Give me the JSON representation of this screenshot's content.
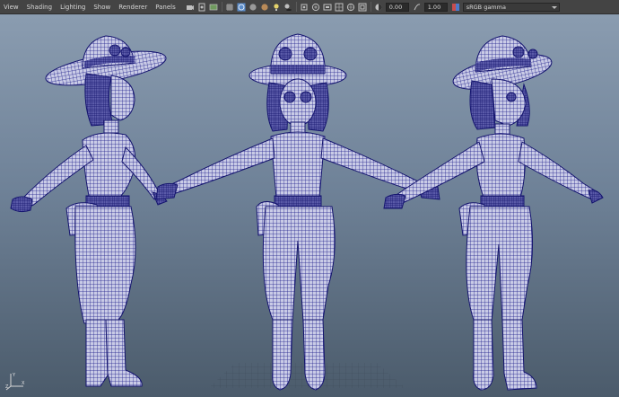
{
  "menu": {
    "items": [
      "View",
      "Shading",
      "Lighting",
      "Show",
      "Renderer",
      "Panels"
    ]
  },
  "toolbar": {
    "icons": [
      "camera-icon",
      "bookmark-icon",
      "image-plane-icon",
      "grid-icon",
      "wireframe-icon",
      "smooth-shade-icon",
      "textured-icon",
      "lights-icon",
      "shadows-icon",
      "isolate-icon",
      "xray-icon",
      "resolution-gate-icon",
      "film-gate-icon",
      "safe-action-icon",
      "field-chart-icon",
      "exposure-icon"
    ],
    "exposure_value": "0.00",
    "gamma_value": "1.00",
    "color_management": "sRGB gamma"
  },
  "viewport": {
    "background_top": "#8a9cb0",
    "background_bottom": "#4b5b6b",
    "wire_color": "#1f1f8a",
    "mesh_fill": "#c9cbe6"
  },
  "axis": {
    "y_label": "Y",
    "x_label": "X",
    "z_label": "Z"
  }
}
